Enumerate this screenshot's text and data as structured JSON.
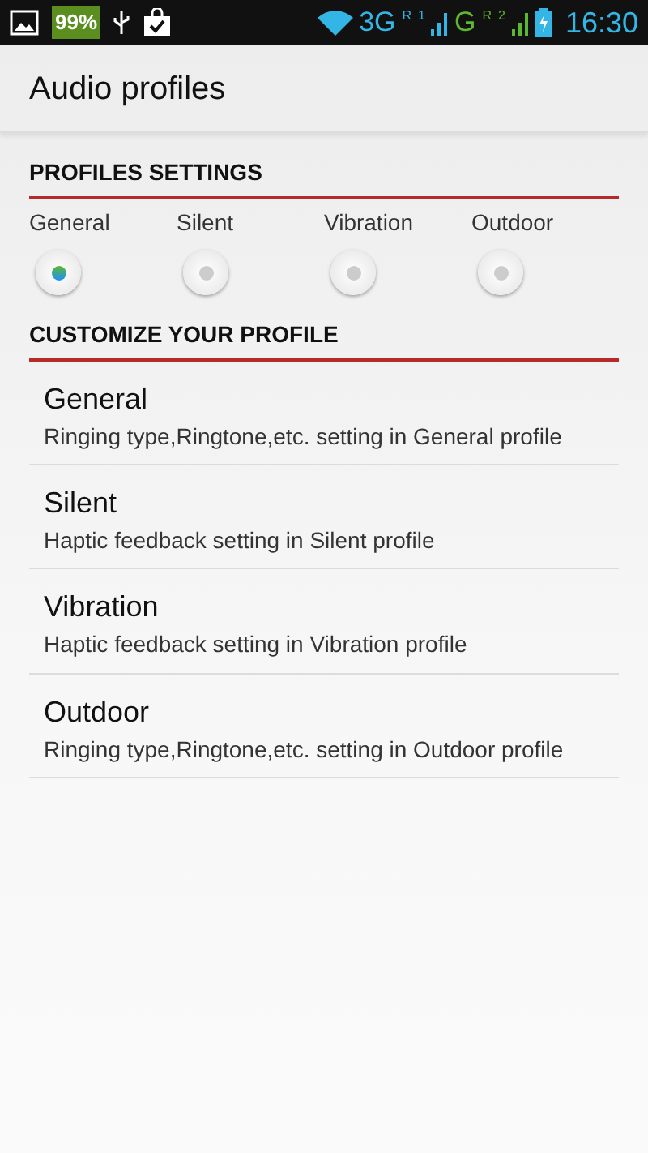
{
  "status_bar": {
    "battery_percent": "99%",
    "network_1": "3G",
    "network_1_roaming": "R",
    "sim_1": "1",
    "network_2": "G",
    "network_2_roaming": "R",
    "sim_2": "2",
    "time": "16:30"
  },
  "title": "Audio profiles",
  "profiles_settings": {
    "heading": "PROFILES SETTINGS",
    "options": [
      {
        "label": "General",
        "selected": true
      },
      {
        "label": "Silent",
        "selected": false
      },
      {
        "label": "Vibration",
        "selected": false
      },
      {
        "label": "Outdoor",
        "selected": false
      }
    ]
  },
  "customize": {
    "heading": "CUSTOMIZE YOUR PROFILE",
    "items": [
      {
        "title": "General",
        "summary": "Ringing type,Ringtone,etc. setting in General profile"
      },
      {
        "title": "Silent",
        "summary": "Haptic feedback setting in Silent profile"
      },
      {
        "title": "Vibration",
        "summary": "Haptic feedback setting in Vibration profile"
      },
      {
        "title": "Outdoor",
        "summary": "Ringing type,Ringtone,etc. setting in Outdoor profile"
      }
    ]
  }
}
